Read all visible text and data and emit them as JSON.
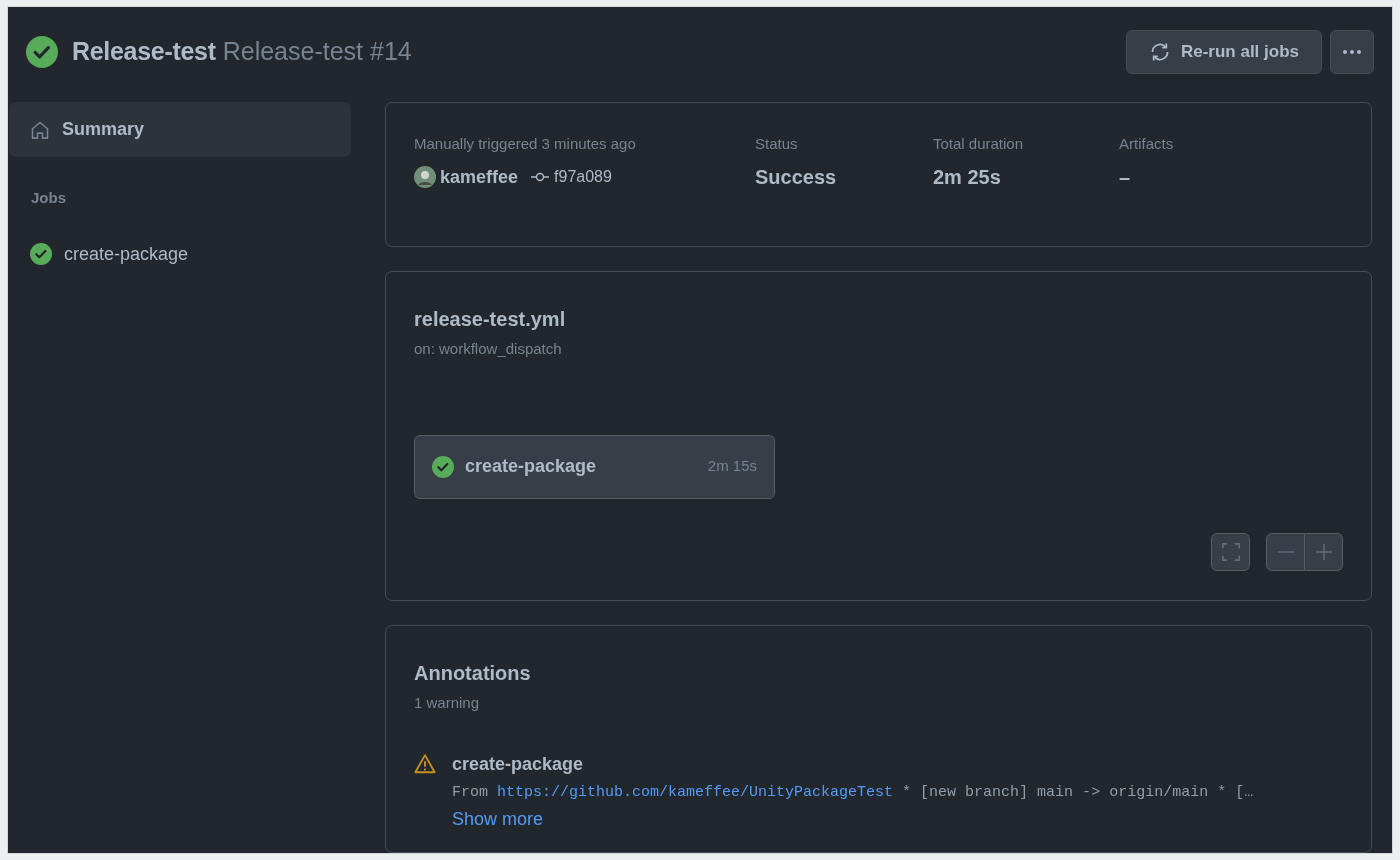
{
  "header": {
    "passed": true,
    "workflow": "Release-test",
    "run": "Release-test #14",
    "buttons": [
      {
        "kind": "rerun",
        "label": "Re-run all jobs"
      },
      {
        "kind": "more"
      }
    ]
  },
  "sidebar": {
    "items": [
      {
        "kind": "summary",
        "label": "Summary",
        "selected": true
      }
    ],
    "section_title": "Jobs",
    "jobs": [
      {
        "label": "create-package",
        "passed": true,
        "selected": false
      }
    ]
  },
  "summary": {
    "trigger": "Manually triggered 3 minutes ago",
    "actor": "kameffee",
    "commit": "f97a089",
    "fields": [
      {
        "label": "Status",
        "value": "Success"
      },
      {
        "label": "Total duration",
        "value": "2m 25s"
      },
      {
        "label": "Artifacts",
        "value": "–"
      }
    ]
  },
  "workflow_graph": {
    "file": "release-test.yml",
    "event": "on: workflow_dispatch",
    "jobs": [
      {
        "name": "create-package",
        "passed": true,
        "duration": "2m 15s"
      }
    ]
  },
  "annotations": {
    "title": "Annotations",
    "count": "1 warning",
    "items": [
      {
        "kind": "warning",
        "job": "create-package",
        "message_prefix": "From ",
        "message_link": "https://github.com/kameffee/UnityPackageTest",
        "message_suffix": " * [new branch] main -> origin/main * […",
        "show_more": "Show more"
      }
    ]
  }
}
